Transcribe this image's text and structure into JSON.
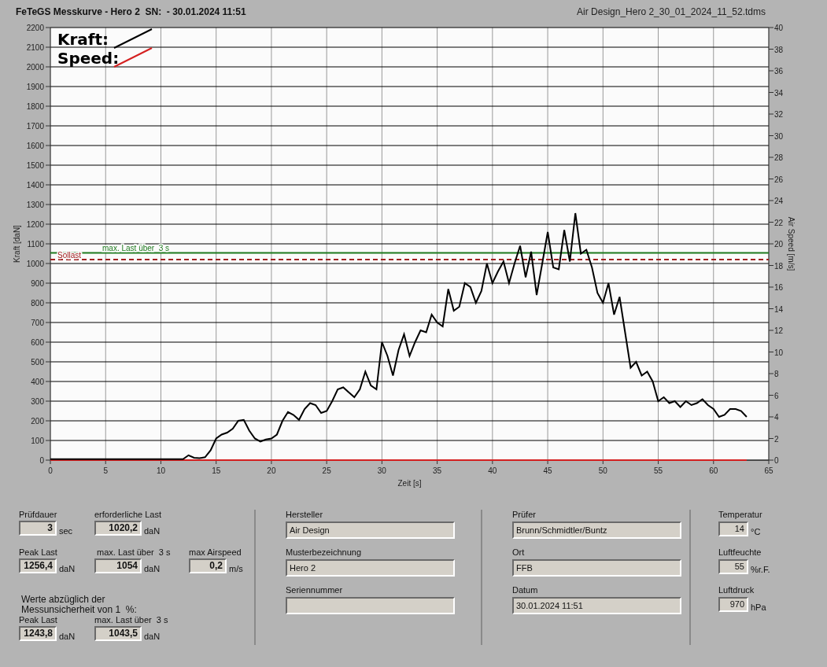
{
  "header": {
    "title": "FeTeGS Messkurve - Hero 2  SN:  - 30.01.2024 11:51",
    "file": "Air Design_Hero 2_30_01_2024_11_52.tdms"
  },
  "chart": {
    "chart_data": {
      "type": "line",
      "xlabel": "Zeit [s]",
      "ylabel": "Kraft [daN]",
      "y2label": "Air Speed [m/s]",
      "x": [
        0,
        1,
        2,
        3,
        4,
        5,
        6,
        7,
        8,
        9,
        10,
        11,
        12,
        12.5,
        13,
        13.5,
        14,
        14.5,
        15,
        15.5,
        16,
        16.5,
        17,
        17.5,
        18,
        18.5,
        19,
        19.5,
        20,
        20.5,
        21,
        21.5,
        22,
        22.5,
        23,
        23.5,
        24,
        24.5,
        25,
        25.5,
        26,
        26.5,
        27,
        27.5,
        28,
        28.5,
        29,
        29.5,
        30,
        30.5,
        31,
        31.5,
        32,
        32.5,
        33,
        33.5,
        34,
        34.5,
        35,
        35.5,
        36,
        36.5,
        37,
        37.5,
        38,
        38.5,
        39,
        39.5,
        40,
        40.5,
        41,
        41.5,
        42,
        42.5,
        43,
        43.5,
        44,
        44.5,
        45,
        45.5,
        46,
        46.5,
        47,
        47.5,
        48,
        48.5,
        49,
        49.5,
        50,
        50.5,
        51,
        51.5,
        52,
        52.5,
        53,
        53.5,
        54,
        54.5,
        55,
        55.5,
        56,
        56.5,
        57,
        57.5,
        58,
        58.5,
        59,
        59.5,
        60,
        60.5,
        61,
        61.5,
        62,
        62.5,
        63
      ],
      "series": [
        {
          "name": "Kraft:",
          "color": "#000000",
          "values": [
            5,
            5,
            5,
            5,
            5,
            5,
            5,
            5,
            5,
            5,
            5,
            5,
            5,
            25,
            12,
            10,
            15,
            50,
            110,
            130,
            140,
            160,
            200,
            205,
            150,
            110,
            95,
            105,
            110,
            130,
            200,
            245,
            230,
            205,
            260,
            290,
            280,
            240,
            250,
            300,
            360,
            370,
            345,
            320,
            360,
            450,
            380,
            360,
            600,
            530,
            430,
            560,
            640,
            530,
            600,
            660,
            650,
            740,
            700,
            680,
            870,
            760,
            780,
            900,
            880,
            800,
            860,
            1000,
            900,
            960,
            1010,
            900,
            1000,
            1090,
            930,
            1060,
            840,
            1000,
            1160,
            980,
            970,
            1170,
            1010,
            1256,
            1050,
            1070,
            980,
            850,
            800,
            900,
            740,
            830,
            650,
            470,
            500,
            430,
            450,
            400,
            300,
            320,
            290,
            300,
            270,
            300,
            280,
            290,
            310,
            280,
            260,
            220,
            230,
            260,
            260,
            250,
            220
          ]
        },
        {
          "name": "Speed:",
          "color": "#d42020",
          "values": [
            0,
            0,
            0,
            0,
            0,
            0,
            0,
            0,
            0,
            0,
            0,
            0,
            0,
            0,
            0,
            0,
            0,
            0,
            0,
            0,
            0,
            0,
            0,
            0,
            0,
            0,
            0,
            0,
            0,
            0,
            0,
            0,
            0,
            0,
            0,
            0,
            0,
            0,
            0,
            0,
            0,
            0,
            0,
            0,
            0,
            0,
            0,
            0,
            0,
            0,
            0,
            0,
            0,
            0,
            0,
            0,
            0,
            0,
            0,
            0,
            0,
            0,
            0,
            0,
            0,
            0,
            0,
            0,
            0,
            0,
            0,
            0,
            0,
            0,
            0,
            0,
            0,
            0,
            0,
            0,
            0,
            0,
            0,
            0,
            0,
            0,
            0,
            0,
            0,
            0,
            0,
            0,
            0,
            0,
            0,
            0,
            0,
            0,
            0,
            0,
            0,
            0,
            0,
            0,
            0,
            0,
            0,
            0,
            0,
            0,
            0,
            0,
            0,
            0,
            0
          ]
        }
      ],
      "xlim": [
        0,
        65
      ],
      "ylim": [
        0,
        2200
      ],
      "y2lim": [
        0,
        40
      ],
      "xticks": [
        0,
        5,
        10,
        15,
        20,
        25,
        30,
        35,
        40,
        45,
        50,
        55,
        60,
        65
      ],
      "yticks": [
        0,
        100,
        200,
        300,
        400,
        500,
        600,
        700,
        800,
        900,
        1000,
        1100,
        1200,
        1300,
        1400,
        1500,
        1600,
        1700,
        1800,
        1900,
        2000,
        2100,
        2200
      ],
      "y2ticks": [
        0,
        2,
        4,
        6,
        8,
        10,
        12,
        14,
        16,
        18,
        20,
        22,
        24,
        26,
        28,
        30,
        32,
        34,
        36,
        38,
        40
      ],
      "grid": true,
      "legend": true,
      "ref_lines": [
        {
          "axis": "y",
          "value": 1054,
          "label": "max. Last über  3 s",
          "color": "#1f7a1f"
        },
        {
          "axis": "y",
          "value": 1020.2,
          "label": "Sollast",
          "color": "#a02020"
        }
      ]
    }
  },
  "results": {
    "rows": [
      [
        {
          "label": "Prüfdauer",
          "value": "3",
          "unit": "sec"
        },
        {
          "label": "erforderliche Last",
          "value": "1020,2",
          "unit": "daN"
        }
      ],
      [
        {
          "label": "Peak Last",
          "value": "1256,4",
          "unit": "daN"
        },
        {
          "label": "max. Last über  3 s",
          "value": "1054",
          "unit": "daN"
        },
        {
          "label": "max Airspeed",
          "value": "0,2",
          "unit": "m/s"
        }
      ]
    ],
    "note": [
      "Werte abzüglich der",
      "Messunsicherheit von 1  %:"
    ],
    "reduced": [
      {
        "label": "Peak Last",
        "value": "1243,8",
        "unit": "daN"
      },
      {
        "label": "max. Last über  3 s",
        "value": "1043,5",
        "unit": "daN"
      }
    ]
  },
  "info_left": [
    {
      "label": "Hersteller",
      "value": "Air Design"
    },
    {
      "label": "Musterbezeichnung",
      "value": "Hero 2"
    },
    {
      "label": "Seriennummer"
    }
  ],
  "info_right": [
    {
      "label": "Prüfer",
      "value": "Brunn/Schmidtler/Buntz"
    },
    {
      "label": "Ort",
      "value": "FFB"
    },
    {
      "label": "Datum",
      "value": "30.01.2024 11:51"
    }
  ],
  "conditions": [
    {
      "label": "Temperatur",
      "value": "14",
      "unit": "°C"
    },
    {
      "label": "Luftfeuchte",
      "value": "55",
      "unit": "%r.F."
    },
    {
      "label": "Luftdruck",
      "value": "970",
      "unit": "hPa"
    }
  ]
}
